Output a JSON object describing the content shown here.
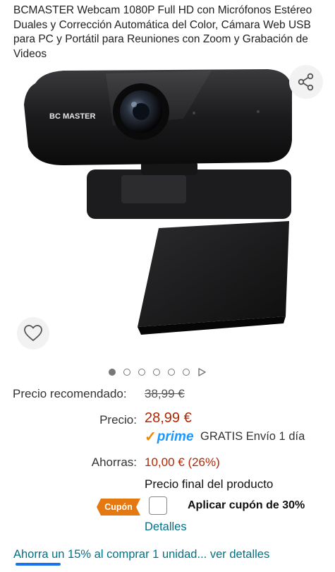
{
  "product": {
    "title": "BCMASTER Webcam 1080P Full HD con Micrófonos Estéreo Duales y Corrección Automática del Color, Cámara Web USB para PC y Portátil para Reuniones con Zoom y Grabación de Videos",
    "image_brand_text": "BC MASTER"
  },
  "gallery": {
    "image_count": 6,
    "active_index": 0,
    "share_icon": "share-icon",
    "wishlist_icon": "heart-icon",
    "video_icon": "play-icon"
  },
  "pricing": {
    "recommended_label": "Precio recomendado:",
    "recommended_value": "38,99 €",
    "price_label": "Precio:",
    "price_value": "28,99 €",
    "prime_label": "prime",
    "shipping_text": "GRATIS Envío 1 día",
    "savings_label": "Ahorras:",
    "savings_value": "10,00 € (26%)",
    "final_price_text": "Precio final del producto"
  },
  "coupon": {
    "badge": "Cupón",
    "text": "Aplicar cupón de 30%",
    "details_link": "Detalles"
  },
  "promo": {
    "text": "Ahorra un 15% al comprar 1 unidad",
    "more_link": "... ver detalles"
  },
  "colors": {
    "price_red": "#b12704",
    "link_teal": "#007185",
    "prime_blue": "#1a98ff",
    "coupon_orange": "#e47911"
  }
}
